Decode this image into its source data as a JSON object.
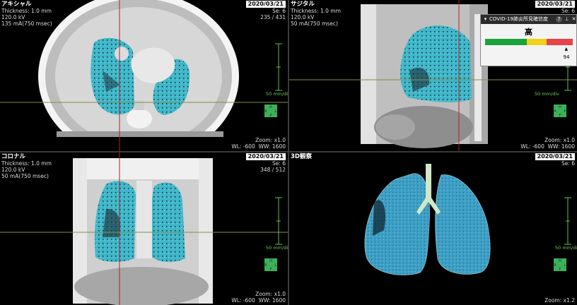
{
  "viewports": {
    "axial": {
      "title": "アキシャル",
      "thickness": "Thickness: 1.0 mm",
      "kv": "120.0 kV",
      "ma": "135 mA(750 msec)",
      "date": "2020/03/21",
      "series": "Se: 6",
      "image": "235 / 431",
      "scale": "50 mm/div",
      "zoom": "Zoom: x1.0",
      "window": "WL: -600  WW: 1600",
      "orientation": {
        "top": "A",
        "bottom": "P",
        "left": "R",
        "right": "L"
      }
    },
    "sagittal": {
      "title": "サジタル",
      "thickness": "Thickness: 1.0 mm",
      "kv": "120.0 kV",
      "ma": "50 mA(750 msec)",
      "date": "2020/03/21",
      "series": "Se: 6",
      "image": "",
      "scale": "50 mm/div",
      "zoom": "Zoom: x1.0",
      "window": "WL: -600  WW: 1600",
      "orientation": {
        "top": "H",
        "bottom": "F",
        "left": "A",
        "right": "P"
      }
    },
    "coronal": {
      "title": "コロナル",
      "thickness": "Thickness: 1.0 mm",
      "kv": "120.0 kV",
      "ma": "50 mA(750 msec)",
      "date": "2020/03/21",
      "series": "Se: 6",
      "image": "348 / 512",
      "scale": "50 mm/div",
      "zoom": "Zoom: x1.0",
      "window": "WL: -600  WW: 1600",
      "orientation": {
        "top": "H",
        "bottom": "F",
        "left": "R",
        "right": "L"
      }
    },
    "view3d": {
      "title": "3D観察",
      "date": "2020/03/21",
      "series": "Se: 6",
      "scale": "50 mm/div",
      "zoom": "Zoom: x1.2",
      "orientation": {
        "top": "H",
        "bottom": "F",
        "left": "R",
        "right": "L"
      }
    }
  },
  "cad_panel": {
    "title": "COVID-19肺炎所見確信度",
    "level": "高",
    "score": "94",
    "score_fraction": 0.94,
    "colors": {
      "green": "#1aa33a",
      "yellow": "#f2d11a",
      "red": "#e5444a"
    }
  },
  "colors": {
    "lesion": "#3fb7c9",
    "crosshair_v": "#b0202a",
    "crosshair_h": "#7f8f4a",
    "scale": "#5fc24a",
    "orient_cube": "#3db05a"
  }
}
